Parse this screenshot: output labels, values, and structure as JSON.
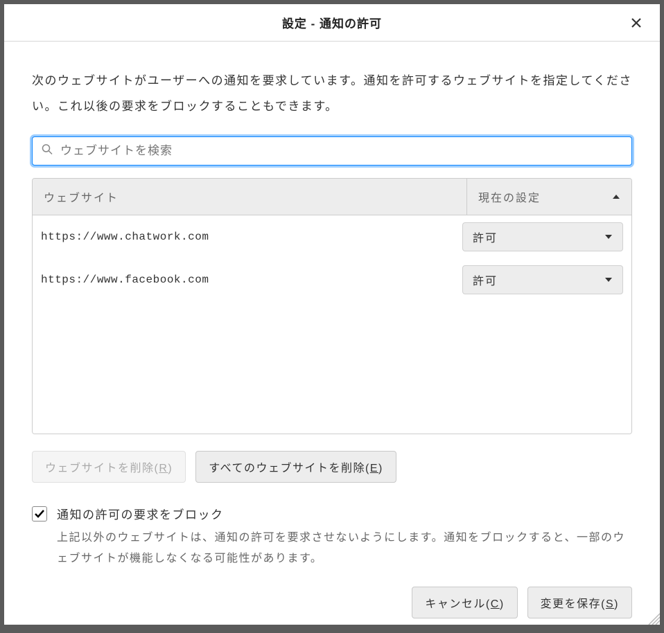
{
  "dialog": {
    "title": "設定 - 通知の許可"
  },
  "description": "次のウェブサイトがユーザーへの通知を要求しています。通知を許可するウェブサイトを指定してください。これ以後の要求をブロックすることもできます。",
  "search": {
    "placeholder": "ウェブサイトを検索",
    "value": ""
  },
  "table": {
    "headers": {
      "website": "ウェブサイト",
      "status": "現在の設定"
    },
    "rows": [
      {
        "website": "https://www.chatwork.com",
        "status": "許可"
      },
      {
        "website": "https://www.facebook.com",
        "status": "許可"
      }
    ]
  },
  "buttons": {
    "remove_site": {
      "text": "ウェブサイトを削除(",
      "key": "R",
      "suffix": ")"
    },
    "remove_all": {
      "text": "すべてのウェブサイトを削除(",
      "key": "E",
      "suffix": ")"
    },
    "cancel": {
      "text": "キャンセル(",
      "key": "C",
      "suffix": ")"
    },
    "save": {
      "text": "変更を保存(",
      "key": "S",
      "suffix": ")"
    }
  },
  "block_new": {
    "checked": true,
    "label": "通知の許可の要求をブロック",
    "description": "上記以外のウェブサイトは、通知の許可を要求させないようにします。通知をブロックすると、一部のウェブサイトが機能しなくなる可能性があります。"
  }
}
